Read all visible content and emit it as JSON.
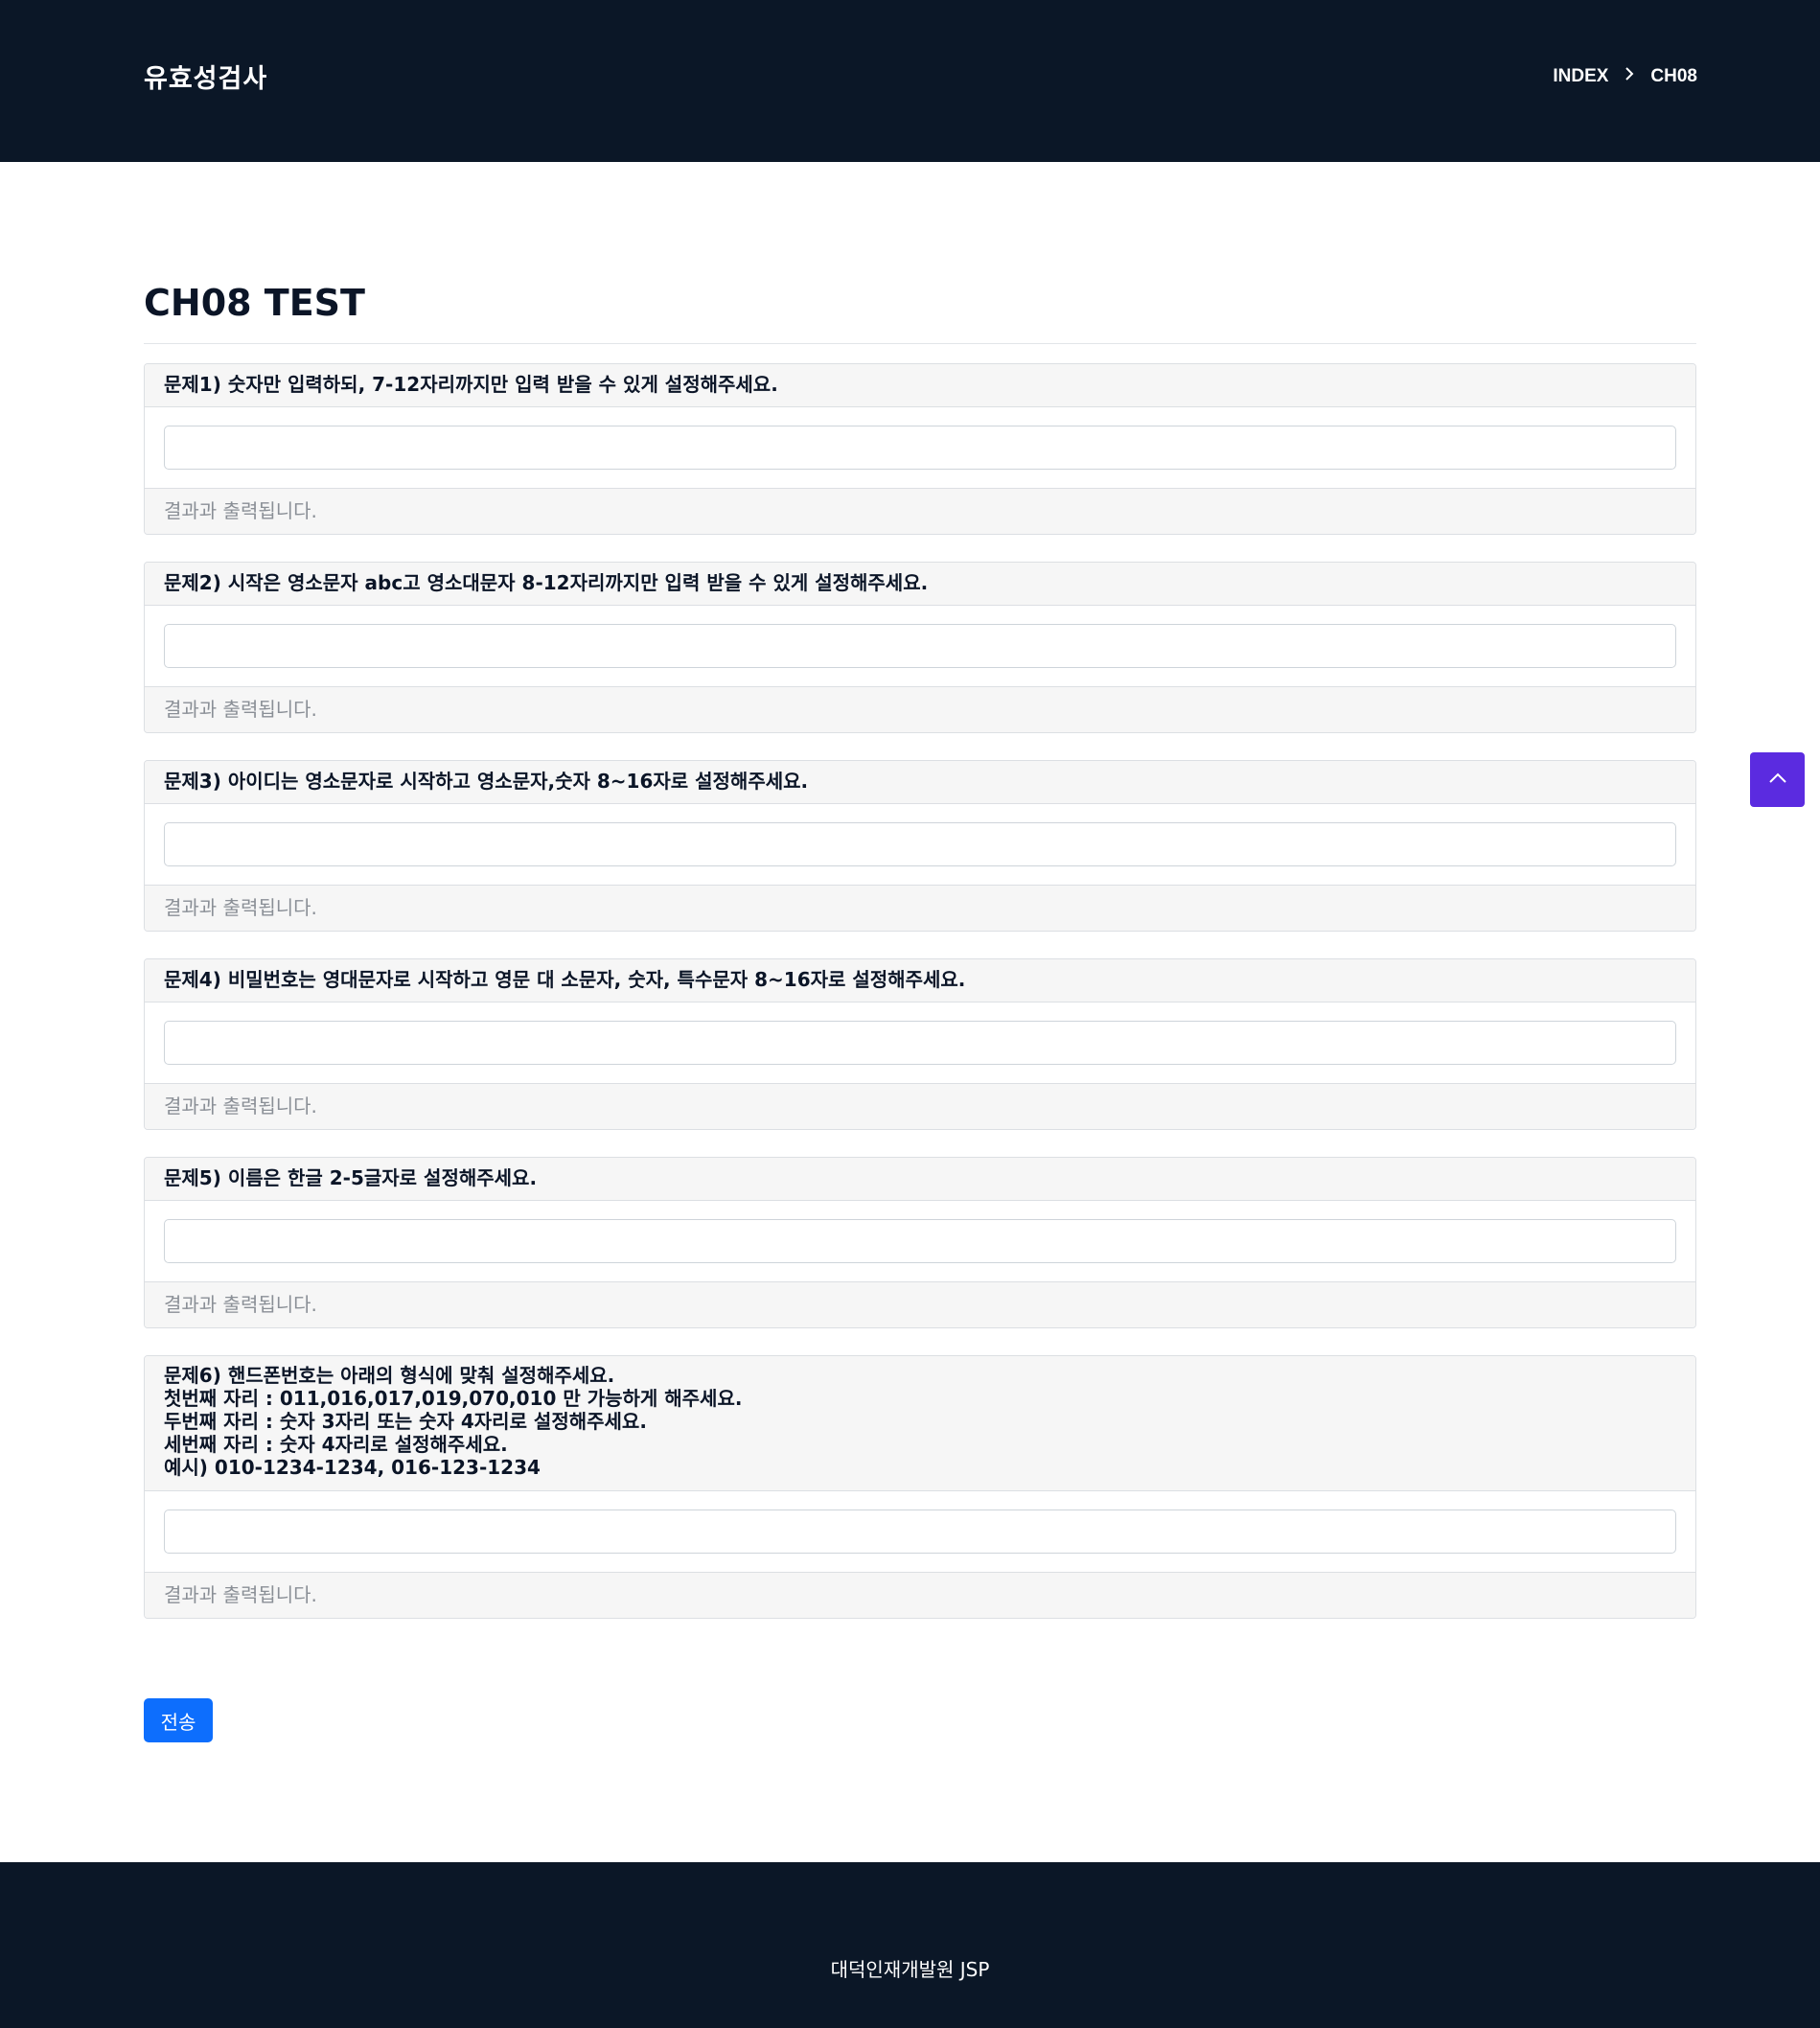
{
  "header": {
    "brand": "유효성검사",
    "breadcrumb": {
      "home": "INDEX",
      "separator_icon": "chevron-right-icon",
      "current": "CH08"
    }
  },
  "page": {
    "title": "CH08 TEST"
  },
  "questions": [
    {
      "title_lines": [
        "문제1) 숫자만 입력하되, 7-12자리까지만 입력 받을 수 있게 설정해주세요."
      ],
      "input_value": "",
      "result": "결과과 출력됩니다."
    },
    {
      "title_lines": [
        "문제2) 시작은 영소문자 abc고 영소대문자 8-12자리까지만 입력 받을 수 있게 설정해주세요."
      ],
      "input_value": "",
      "result": "결과과 출력됩니다."
    },
    {
      "title_lines": [
        "문제3) 아이디는 영소문자로 시작하고 영소문자,숫자 8~16자로 설정해주세요."
      ],
      "input_value": "",
      "result": "결과과 출력됩니다."
    },
    {
      "title_lines": [
        "문제4) 비밀번호는 영대문자로 시작하고 영문 대 소문자, 숫자, 특수문자 8~16자로 설정해주세요."
      ],
      "input_value": "",
      "result": "결과과 출력됩니다."
    },
    {
      "title_lines": [
        "문제5) 이름은 한글 2-5글자로 설정해주세요."
      ],
      "input_value": "",
      "result": "결과과 출력됩니다."
    },
    {
      "title_lines": [
        "문제6) 핸드폰번호는 아래의 형식에 맞춰 설정해주세요.",
        "첫번째 자리 : 011,016,017,019,070,010 만 가능하게 해주세요.",
        "두번째 자리 : 숫자 3자리 또는 숫자 4자리로 설정해주세요.",
        "세번째 자리 : 숫자 4자리로 설정해주세요.",
        "예시) 010-1234-1234, 016-123-1234"
      ],
      "input_value": "",
      "result": "결과과 출력됩니다."
    }
  ],
  "actions": {
    "submit_label": "전송",
    "scroll_top_icon": "chevron-up-icon"
  },
  "footer": {
    "text": "대덕인재개발원 JSP"
  },
  "colors": {
    "header_bg": "#0b1727",
    "submit_bg": "#0d6efd",
    "scroll_top_bg": "#5b2be0"
  }
}
